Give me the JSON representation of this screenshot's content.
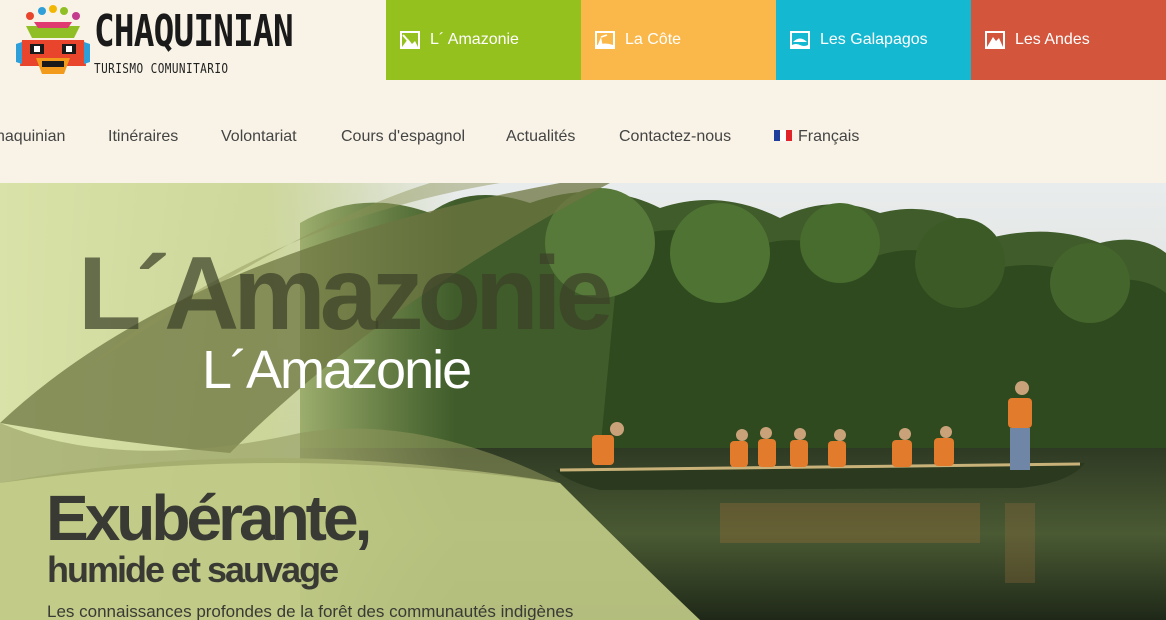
{
  "logo": {
    "title": "CHAQUINIAN",
    "subtitle": "TURISMO COMUNITARIO"
  },
  "regions": [
    {
      "label": "L´ Amazonie",
      "color": "#95c11f",
      "icon": "landscape-icon"
    },
    {
      "label": "La Côte",
      "color": "#fbb84a",
      "icon": "coast-icon"
    },
    {
      "label": "Les Galapagos",
      "color": "#15b8d1",
      "icon": "island-icon"
    },
    {
      "label": "Les Andes",
      "color": "#d2553c",
      "icon": "mountain-icon"
    }
  ],
  "nav": {
    "items": [
      "haquinian",
      "Itinéraires",
      "Volontariat",
      "Cours d'espagnol",
      "Actualités",
      "Contactez-nous"
    ],
    "language": "Français"
  },
  "hero": {
    "watermark": "L´Amazonie",
    "title": "L´Amazonie",
    "headline": "Exubérante,",
    "subheadline": "humide et sauvage",
    "description": "Les connaissances profondes de la forêt des communautés indigènes"
  }
}
